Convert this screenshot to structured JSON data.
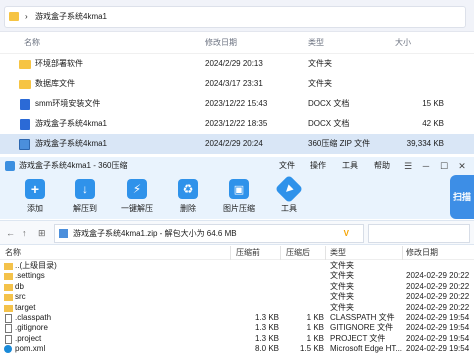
{
  "explorer": {
    "breadcrumb_sep": "›",
    "path_label": "游戏盒子系统4kma1",
    "columns": {
      "name": "名称",
      "date": "修改日期",
      "type": "类型",
      "size": "大小"
    },
    "rows": [
      {
        "name": "环境部署软件",
        "date": "2024/2/29 20:13",
        "type": "文件夹",
        "size": "",
        "icon": "folder-icon"
      },
      {
        "name": "数据库文件",
        "date": "2024/3/17 23:31",
        "type": "文件夹",
        "size": "",
        "icon": "folder-icon"
      },
      {
        "name": "smm环境安装文件",
        "date": "2023/12/22 15:43",
        "type": "DOCX 文档",
        "size": "15 KB",
        "icon": "docx-icon"
      },
      {
        "name": "游戏盒子系统4kma1",
        "date": "2023/12/22 18:35",
        "type": "DOCX 文档",
        "size": "42 KB",
        "icon": "docx-icon"
      },
      {
        "name": "游戏盒子系统4kma1",
        "date": "2024/2/29 20:24",
        "type": "360压缩 ZIP 文件",
        "size": "39,334 KB",
        "icon": "zip-icon",
        "selected": true
      }
    ]
  },
  "zip": {
    "title": "游戏盒子系统4kma1 - 360压缩",
    "menu": [
      "文件",
      "操作",
      "工具",
      "帮助"
    ],
    "side_label": "扫描",
    "toolbar": [
      {
        "label": "添加",
        "icon": "add-icon",
        "color": "#2b8be8"
      },
      {
        "label": "解压到",
        "icon": "extract-to-icon",
        "color": "#2b8be8"
      },
      {
        "label": "一键解压",
        "icon": "one-click-extract-icon",
        "color": "#2b8be8"
      },
      {
        "label": "删除",
        "icon": "delete-icon",
        "color": "#2b8be8"
      },
      {
        "label": "图片压缩",
        "icon": "image-compress-icon",
        "color": "#2b8be8"
      },
      {
        "label": "工具",
        "icon": "tools-icon",
        "color": "#2b8be8"
      }
    ],
    "path_text": "游戏盒子系统4kma1.zip - 解包大小为 64.6 MB",
    "columns": {
      "name": "名称",
      "compressed": "压缩前",
      "original": "压缩后",
      "type": "类型",
      "date": "修改日期"
    },
    "rows": [
      {
        "name": "..(上级目录)",
        "compressed": "",
        "original": "",
        "type": "文件夹",
        "date": "",
        "kind": "folder"
      },
      {
        "name": ".settings",
        "compressed": "",
        "original": "",
        "type": "文件夹",
        "date": "2024-02-29 20:22",
        "kind": "folder"
      },
      {
        "name": "db",
        "compressed": "",
        "original": "",
        "type": "文件夹",
        "date": "2024-02-29 20:22",
        "kind": "folder"
      },
      {
        "name": "src",
        "compressed": "",
        "original": "",
        "type": "文件夹",
        "date": "2024-02-29 20:22",
        "kind": "folder"
      },
      {
        "name": "target",
        "compressed": "",
        "original": "",
        "type": "文件夹",
        "date": "2024-02-29 20:22",
        "kind": "folder"
      },
      {
        "name": ".classpath",
        "compressed": "1.3 KB",
        "original": "1 KB",
        "type": "CLASSPATH 文件",
        "date": "2024-02-29 19:54",
        "kind": "doc"
      },
      {
        "name": ".gitignore",
        "compressed": "1.3 KB",
        "original": "1 KB",
        "type": "GITIGNORE 文件",
        "date": "2024-02-29 19:54",
        "kind": "doc"
      },
      {
        "name": ".project",
        "compressed": "1.3 KB",
        "original": "1 KB",
        "type": "PROJECT 文件",
        "date": "2024-02-29 19:54",
        "kind": "doc"
      },
      {
        "name": "pom.xml",
        "compressed": "8.0 KB",
        "original": "1.5 KB",
        "type": "Microsoft Edge HT...",
        "date": "2024-02-29 19:54",
        "kind": "edge"
      }
    ]
  }
}
